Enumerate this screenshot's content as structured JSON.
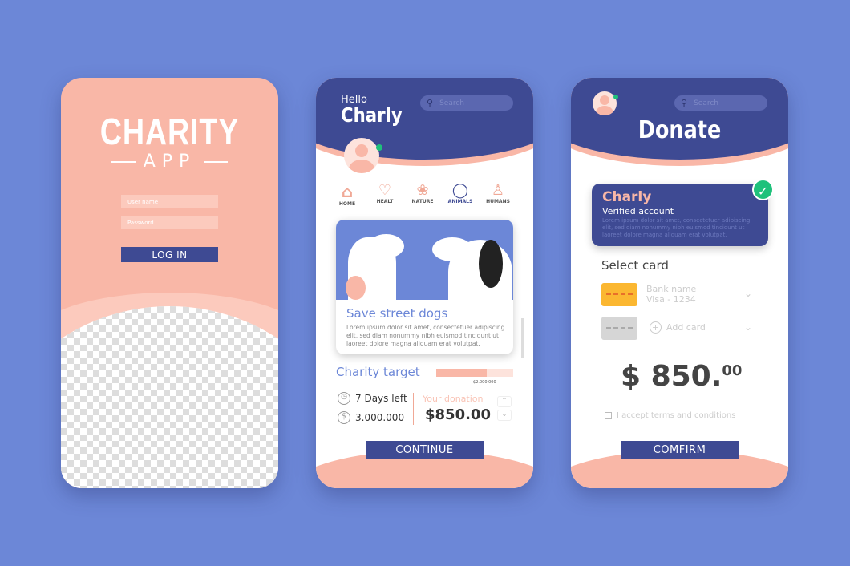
{
  "login": {
    "title": "CHARITY",
    "subtitle": "APP",
    "username_placeholder": "User name",
    "password_placeholder": "Password",
    "login_button": "LOG IN"
  },
  "home": {
    "greeting": "Hello",
    "name": "Charly",
    "search_placeholder": "Search",
    "categories": [
      {
        "label": "HOME",
        "icon": "house-icon"
      },
      {
        "label": "HEALT",
        "icon": "heart-icon"
      },
      {
        "label": "NATURE",
        "icon": "sprout-icon"
      },
      {
        "label": "ANIMALS",
        "icon": "dog-icon"
      },
      {
        "label": "HUMANS",
        "icon": "person-icon"
      }
    ],
    "card": {
      "title": "Save street dogs",
      "text": "Lorem ipsum dolor sit amet, consectetuer adipiscing elit, sed diam nonummy nibh euismod tincidunt ut laoreet dolore magna aliquam erat volutpat."
    },
    "target": {
      "label": "Charity target",
      "goal": "$2.000.000",
      "progress": 0.66,
      "days_left": "7 Days left",
      "raised": "3.000.000",
      "donation_label": "Your donation",
      "donation_value": "$850.00"
    },
    "continue_button": "CONTINUE"
  },
  "donate": {
    "title": "Donate",
    "search_placeholder": "Search",
    "account": {
      "name": "Charly",
      "status": "Verified account",
      "text": "Lorem ipsum dolor sit amet, consectetuer adipiscing elit, sed diam nonummy nibh euismod tincidunt ut laoreet dolore magna aliquam erat volutpat."
    },
    "select_card_label": "Select card",
    "cards": [
      {
        "bank": "Bank name",
        "number": "Visa - 1234",
        "color": "#fbb731"
      }
    ],
    "add_card": "Add card",
    "amount": "$ 850.",
    "amount_cents": "00",
    "terms": "I accept terms and conditions",
    "confirm_button": "COMFIRM"
  },
  "colors": {
    "background": "#6c87d7",
    "navy": "#3e4a93",
    "salmon": "#f9b7a7",
    "green": "#1fc17b"
  }
}
